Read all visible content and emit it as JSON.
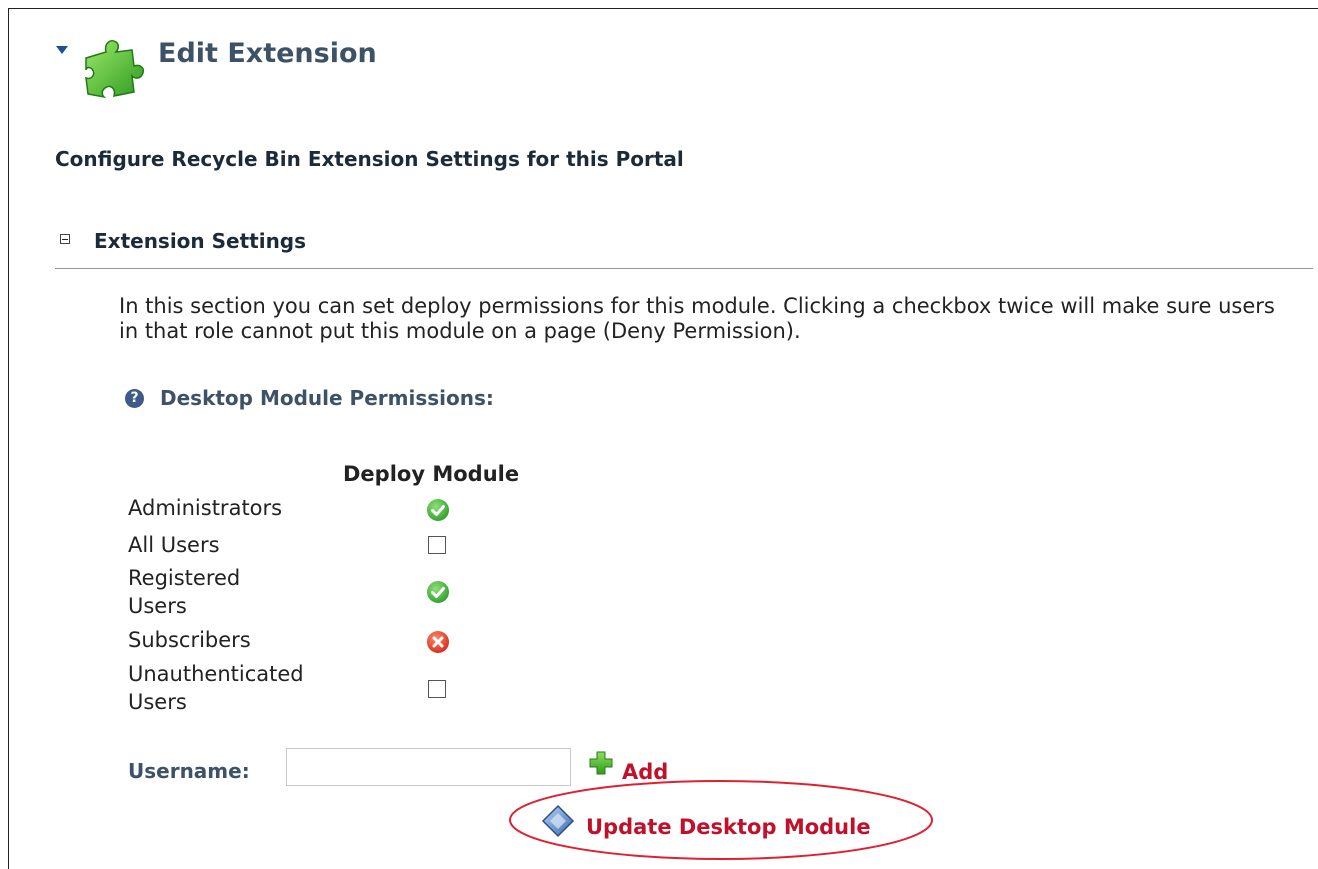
{
  "header": {
    "title": "Edit Extension",
    "icon": "puzzle-piece-icon"
  },
  "subtitle": "Configure Recycle Bin Extension Settings for this Portal",
  "section": {
    "title": "Extension Settings",
    "expanded": true,
    "description": "In this section you can set deploy permissions for this module. Clicking a checkbox twice will make sure users in that role cannot put this module on a page (Deny Permission)."
  },
  "permissions": {
    "label": "Desktop Module Permissions:",
    "column_header": "Deploy Module",
    "roles": [
      {
        "name": "Administrators",
        "state": "granted"
      },
      {
        "name": "All Users",
        "state": "unset"
      },
      {
        "name": "Registered Users",
        "state": "granted"
      },
      {
        "name": "Subscribers",
        "state": "denied"
      },
      {
        "name": "Unauthenticated Users",
        "state": "unset"
      }
    ]
  },
  "username": {
    "label": "Username:",
    "value": "",
    "add_label": "Add"
  },
  "update_button": {
    "label": "Update Desktop Module"
  },
  "colors": {
    "title": "#3d5266",
    "action_link": "#c0102a",
    "granted": "#3cb43c",
    "denied": "#e0402a",
    "highlight_ellipse": "#e02030"
  }
}
